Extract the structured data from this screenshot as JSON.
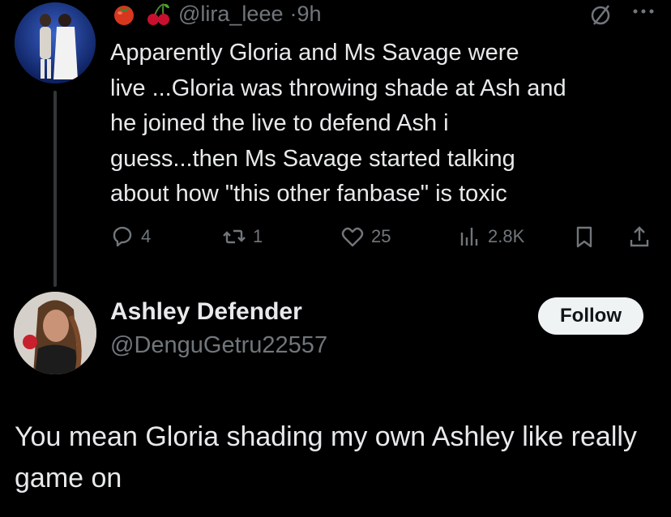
{
  "tweet1": {
    "handle": "@lira_leee",
    "separator": "·",
    "time": "9h",
    "emojis": [
      "tomato-emoji",
      "cherries-emoji"
    ],
    "text": "Apparently Gloria and Ms Savage were\nlive ...Gloria was throwing shade at Ash and\nhe joined the live to defend Ash i\nguess...then Ms Savage started talking\nabout how \"this other fanbase\" is toxic",
    "actions": {
      "replies": "4",
      "reposts": "1",
      "likes": "25",
      "views": "2.8K"
    }
  },
  "tweet2": {
    "display_name": "Ashley Defender",
    "handle": "@DenguGetru22557",
    "follow_label": "Follow",
    "text": "You mean Gloria shading my own Ashley like really game on"
  },
  "colors": {
    "background": "#000000",
    "primary_text": "#e7e9ea",
    "secondary_text": "#71767b",
    "follow_button_bg": "#eff3f4",
    "follow_button_text": "#0f1419",
    "thread_line": "#333639"
  }
}
